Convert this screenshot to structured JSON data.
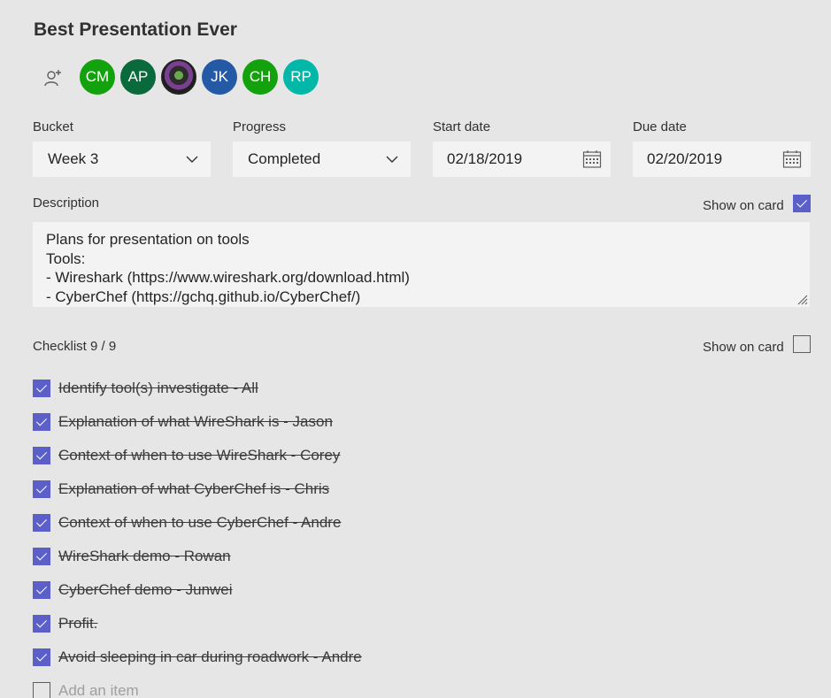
{
  "task": {
    "title": "Best Presentation Ever"
  },
  "assign": {
    "icon": "add-person-icon"
  },
  "assignees": [
    {
      "initials": "CM",
      "color": "#13a10e"
    },
    {
      "initials": "AP",
      "color": "#0b6a3b"
    },
    {
      "initials": "",
      "color": "#2b2b2b"
    },
    {
      "initials": "JK",
      "color": "#2459a6"
    },
    {
      "initials": "CH",
      "color": "#13a10e"
    },
    {
      "initials": "RP",
      "color": "#00b7a8"
    }
  ],
  "bucket": {
    "label": "Bucket",
    "value": "Week 3"
  },
  "progress": {
    "label": "Progress",
    "value": "Completed"
  },
  "start_date": {
    "label": "Start date",
    "value": "02/18/2019",
    "icon": "calendar-icon"
  },
  "due_date": {
    "label": "Due date",
    "value": "02/20/2019",
    "icon": "calendar-icon"
  },
  "description": {
    "label": "Description",
    "show_on_card_label": "Show on card",
    "show_on_card": true,
    "lines": [
      "Plans for presentation on tools",
      "Tools:",
      "- Wireshark (https://www.wireshark.org/download.html)",
      "- CyberChef (https://gchq.github.io/CyberChef/)"
    ]
  },
  "checklist": {
    "title": "Checklist 9 / 9",
    "show_on_card_label": "Show on card",
    "show_on_card": false,
    "items": [
      {
        "text": "Identify tool(s) investigate - All",
        "checked": true
      },
      {
        "text": "Explanation of what WireShark is - Jason",
        "checked": true
      },
      {
        "text": "Context of when to use WireShark - Corey",
        "checked": true
      },
      {
        "text": "Explanation of what CyberChef is - Chris",
        "checked": true
      },
      {
        "text": "Context of when to use CyberChef - Andre",
        "checked": true
      },
      {
        "text": "WireShark demo - Rowan",
        "checked": true
      },
      {
        "text": "CyberChef demo - Junwei",
        "checked": true
      },
      {
        "text": "Profit.",
        "checked": true
      },
      {
        "text": "Avoid sleeping in car during roadwork - Andre",
        "checked": true
      }
    ],
    "add_placeholder": "Add an item"
  },
  "colors": {
    "accent": "#5b5fc7",
    "background": "#e6e6e6",
    "field": "#f3f3f3"
  }
}
